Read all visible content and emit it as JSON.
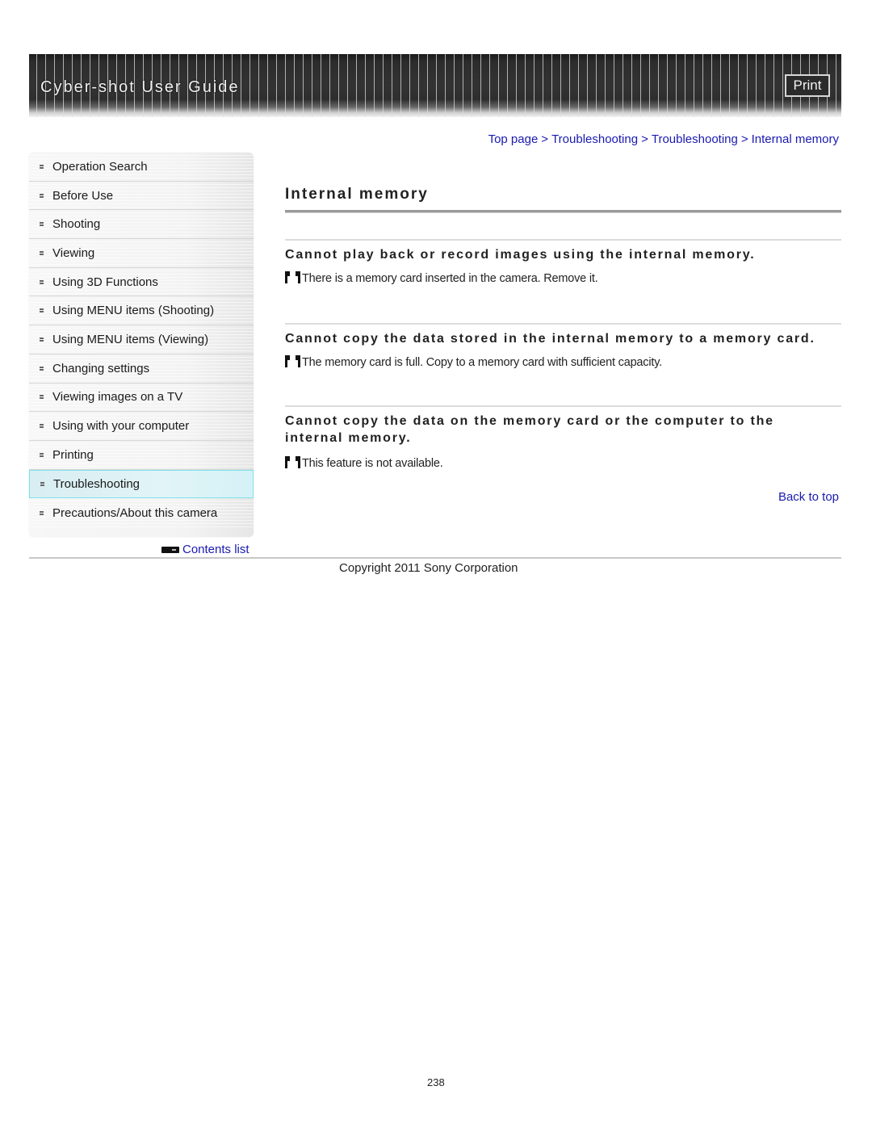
{
  "header": {
    "title": "Cyber-shot User Guide",
    "print_label": "Print"
  },
  "sidebar": {
    "items": [
      {
        "label": "Operation Search",
        "active": false
      },
      {
        "label": "Before Use",
        "active": false
      },
      {
        "label": "Shooting",
        "active": false
      },
      {
        "label": "Viewing",
        "active": false
      },
      {
        "label": "Using 3D Functions",
        "active": false
      },
      {
        "label": "Using MENU items (Shooting)",
        "active": false
      },
      {
        "label": "Using MENU items (Viewing)",
        "active": false
      },
      {
        "label": "Changing settings",
        "active": false
      },
      {
        "label": "Viewing images on a TV",
        "active": false
      },
      {
        "label": "Using with your computer",
        "active": false
      },
      {
        "label": "Printing",
        "active": false
      },
      {
        "label": "Troubleshooting",
        "active": true
      },
      {
        "label": "Precautions/About this camera",
        "active": false
      }
    ],
    "contents_list_label": "Contents list"
  },
  "breadcrumb": {
    "items": [
      "Top page",
      "Troubleshooting",
      "Troubleshooting",
      "Internal memory"
    ],
    "separator": ">"
  },
  "main": {
    "title": "Internal memory",
    "sections": [
      {
        "heading": "Cannot play back or record images using the internal memory.",
        "answer": "There is a memory card inserted in the camera. Remove it."
      },
      {
        "heading": "Cannot copy the data stored in the internal memory to a memory card.",
        "answer": "The memory card is full. Copy to a memory card with sufficient capacity."
      },
      {
        "heading": "Cannot copy the data on the memory card or the computer to the internal memory.",
        "answer": "This feature is not available."
      }
    ],
    "back_to_top_label": "Back to top"
  },
  "footer": {
    "copyright": "Copyright 2011 Sony Corporation",
    "page_number": "238"
  },
  "colors": {
    "link": "#1a1ab0",
    "active_nav_border": "#7fe2ee",
    "banner_bg": "#333333"
  }
}
